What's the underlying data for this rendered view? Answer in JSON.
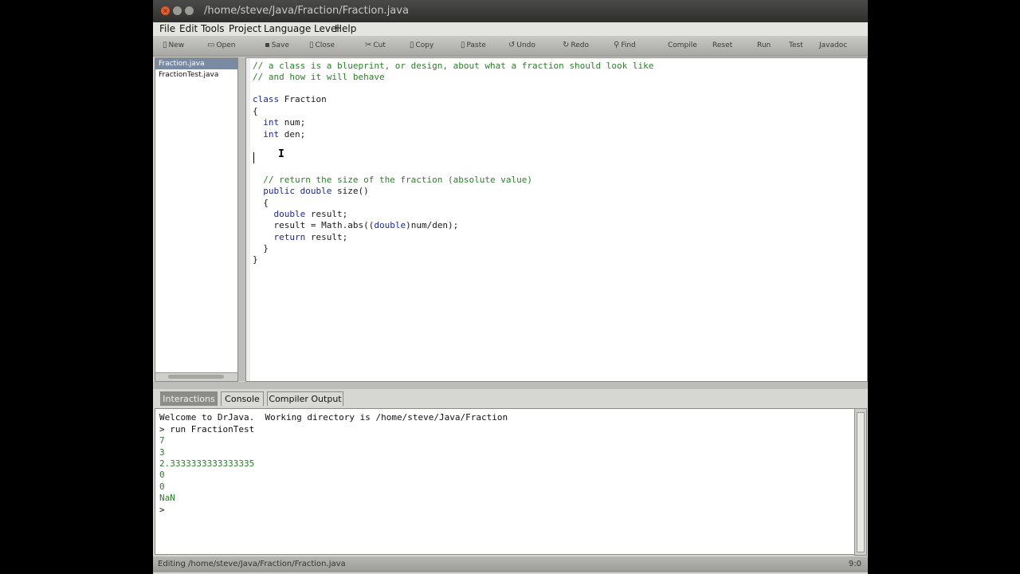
{
  "window": {
    "title": "/home/steve/Java/Fraction/Fraction.java",
    "close_glyph": "×"
  },
  "menu": [
    "File",
    "Edit",
    "Tools",
    "Project",
    "Language Level",
    "Help"
  ],
  "toolbar": {
    "new": "New",
    "open": "Open",
    "save": "Save",
    "close": "Close",
    "cut": "Cut",
    "copy": "Copy",
    "paste": "Paste",
    "undo": "Undo",
    "redo": "Redo",
    "find": "Find",
    "compile": "Compile",
    "reset": "Reset",
    "run": "Run",
    "test": "Test",
    "javadoc": "Javadoc"
  },
  "files": [
    "Fraction.java",
    "FractionTest.java"
  ],
  "selected_file": "Fraction.java",
  "code": [
    "// a class is a blueprint, or design, about what a fraction should look like",
    "// and how it will behave",
    "",
    "class Fraction",
    "{",
    "  int num;",
    "  int den;",
    "",
    "",
    "",
    "  // return the size of the fraction (absolute value)",
    "  public double size()",
    "  {",
    "    double result;",
    "    result = Math.abs((double)num/den);",
    "    return result;",
    "  }",
    "}"
  ],
  "tabs": [
    "Interactions",
    "Console",
    "Compiler Output"
  ],
  "active_tab": "Interactions",
  "console": [
    "Welcome to DrJava.  Working directory is /home/steve/Java/Fraction",
    "> run FractionTest",
    "7",
    "3",
    "2.3333333333333335",
    "0",
    "0",
    "NaN",
    ">"
  ],
  "status": {
    "text": "Editing /home/steve/Java/Fraction/Fraction.java",
    "position": "9:0"
  },
  "colors": {
    "keyword": "#1e2a8c",
    "comment": "#2c7d2c",
    "output": "#2c7d2c",
    "selected_tab": "#8c8c88"
  }
}
